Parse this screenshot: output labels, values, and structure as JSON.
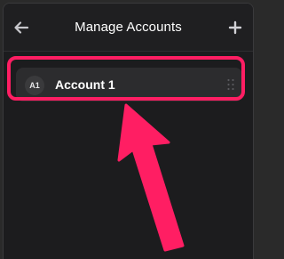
{
  "header": {
    "title": "Manage Accounts",
    "back_icon": "arrow-left-icon",
    "add_icon": "plus-icon"
  },
  "accounts": [
    {
      "initials": "A1",
      "name": "Account 1",
      "drag_icon": "drag-handle-icon"
    }
  ],
  "annotation": {
    "highlight_color": "#ff1e63",
    "arrow_color": "#ff1e63"
  },
  "colors": {
    "background": "#1c1c1e",
    "row": "#2c2c2e",
    "text": "#ffffff"
  }
}
